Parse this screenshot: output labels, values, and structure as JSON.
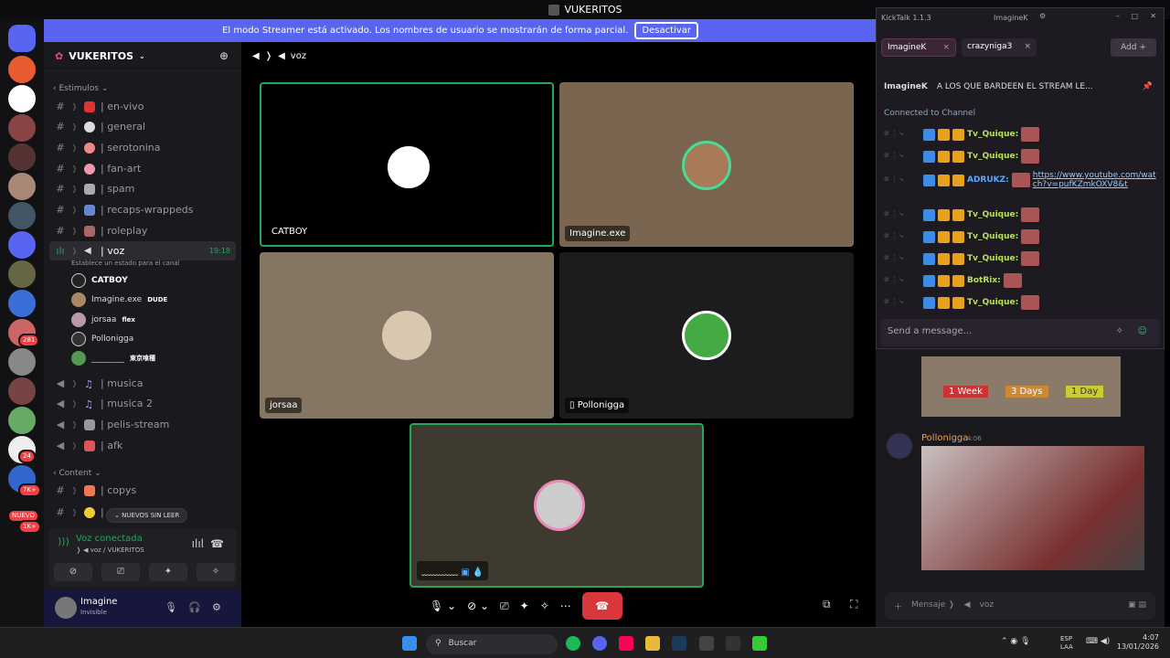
{
  "window": {
    "title": "VUKERITOS"
  },
  "banner": {
    "text": "El modo Streamer está activado. Los nombres de usuario se mostrarán de forma parcial.",
    "button": "Desactivar"
  },
  "rail": {
    "badges": [
      "281",
      "24",
      "7K+",
      "NUEVO",
      "1K+"
    ]
  },
  "server": {
    "name": "VUKERITOS"
  },
  "categories": {
    "estimulos": "Estimulos",
    "content": "Content"
  },
  "channels": [
    {
      "name": "| en-vivo"
    },
    {
      "name": "| general"
    },
    {
      "name": "| serotonina"
    },
    {
      "name": "| fan-art"
    },
    {
      "name": "| spam"
    },
    {
      "name": "| recaps-wrappeds"
    },
    {
      "name": "| roleplay"
    }
  ],
  "voice": {
    "name": "| voz",
    "time": "19:18",
    "status_hint": "Establece un estado para el canal"
  },
  "voice_users": [
    {
      "name": "CATBOY",
      "tag": ""
    },
    {
      "name": "Imagine.exe",
      "tag": "DUDE"
    },
    {
      "name": "jorsaa",
      "tag": "flex"
    },
    {
      "name": "Pollonigga",
      "tag": ""
    },
    {
      "name": "﹏﹏﹏﹏",
      "tag": "東京喰種"
    }
  ],
  "voice_channels": [
    {
      "name": "| musica"
    },
    {
      "name": "| musica 2"
    },
    {
      "name": "| pelis-stream"
    },
    {
      "name": "| afk"
    }
  ],
  "content_channels": [
    {
      "name": "| copys"
    },
    {
      "name": "|"
    }
  ],
  "new_unread": "NUEVOS SIN LEER",
  "voice_panel": {
    "status": "Voz conectada",
    "location": "voz / VUKERITOS"
  },
  "user": {
    "name": "Imagine",
    "status": "Invisible"
  },
  "stage": {
    "header": "voz"
  },
  "tiles": [
    {
      "label": "CATBOY"
    },
    {
      "label": "Imagine.exe"
    },
    {
      "label": "jorsaa"
    },
    {
      "label": "Pollonigga"
    },
    {
      "label": "﹏﹏﹏﹏"
    }
  ],
  "kicktalk": {
    "title": "KickTalk 1.1.3",
    "account": "ImagineK",
    "tabs": [
      "ImagineK",
      "crazyniga3"
    ],
    "add": "Add",
    "pinned_user": "ImagineK",
    "pinned_text": "A LOS QUE BARDEEN EL STREAM LE...",
    "connected": "Connected to Channel",
    "messages": [
      {
        "user": "Tv_Quique:",
        "text": "",
        "color": "#b8e05a"
      },
      {
        "user": "Tv_Quique:",
        "text": "",
        "color": "#b8e05a"
      },
      {
        "user": "ADRUKZ:",
        "text": "https://www.youtube.com/watch?v=pufKZmkOXV8&t",
        "color": "#5aa8ff"
      },
      {
        "user": "Tv_Quique:",
        "text": "",
        "color": "#b8e05a"
      },
      {
        "user": "Tv_Quique:",
        "text": "",
        "color": "#b8e05a"
      },
      {
        "user": "Tv_Quique:",
        "text": "",
        "color": "#b8e05a"
      },
      {
        "user": "BotRix:",
        "text": "",
        "color": "#b8e05a"
      },
      {
        "user": "Tv_Quique:",
        "text": "",
        "color": "#b8e05a"
      }
    ],
    "input_placeholder": "Send a message..."
  },
  "chat": {
    "ban_options": [
      "1 Week",
      "3 Days",
      "1 Day"
    ],
    "author": "Pollonigga",
    "time": "4:06",
    "input": "Mensaje ❭",
    "input_channel": "voz"
  },
  "taskbar": {
    "search": "Buscar",
    "lang1": "ESP",
    "lang2": "LAA",
    "time": "4:07",
    "date": "13/01/2026"
  }
}
